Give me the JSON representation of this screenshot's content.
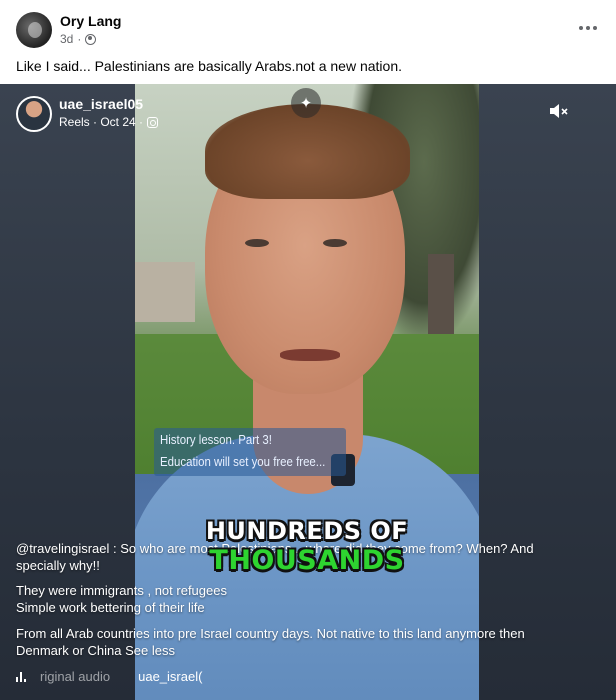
{
  "post": {
    "author": "Ory Lang",
    "time": "3d",
    "privacy_icon": "globe-icon",
    "more_icon": "more-horizontal-icon",
    "caption": "Like I said... Palestinians are basically Arabs.not a new nation."
  },
  "reel": {
    "username": "uae_israel05",
    "meta": "Reels · Oct 24 ·",
    "source_icon": "instagram-icon",
    "sparkle_icon": "sparkle-icon",
    "mute_icon": "speaker-muted-icon",
    "overlay_text": {
      "line1": "History lesson. Part 3!",
      "line2": "Education will set you free free..."
    },
    "subtitle": {
      "line1": "HUNDREDS OF",
      "line2": "THOUSANDS"
    },
    "description": {
      "p1": "@travelingisrael : So who are most Palestinians... where did they come from? When? And specially why!!",
      "p2a": "They were immigrants , not refugees",
      "p2b": "Simple work bettering of their life",
      "p3": "From all Arab countries into pre Israel country days. Not native to this land anymore then Denmark or China See less"
    },
    "audio": {
      "icon": "audio-bars-icon",
      "label": "riginal audio",
      "user": "uae_israel("
    }
  },
  "colors": {
    "subtitle_green": "#2ed430",
    "reel_background": "#2c3440",
    "overlay_blue": "#285a96"
  }
}
